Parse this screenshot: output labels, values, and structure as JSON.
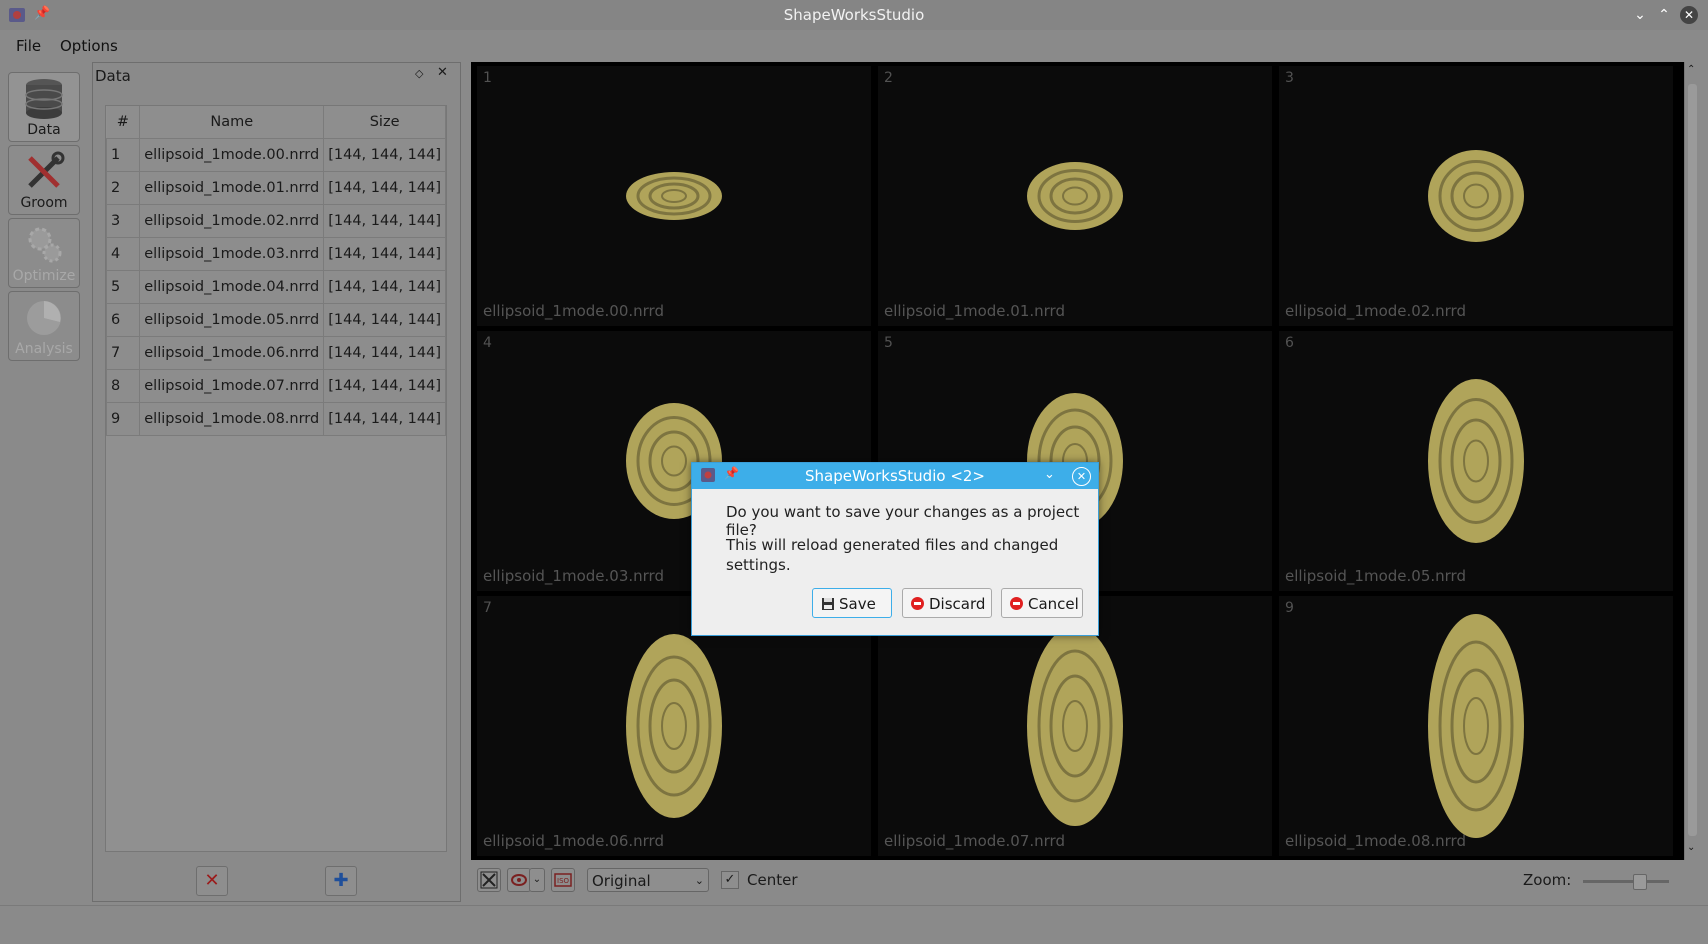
{
  "window": {
    "title": "ShapeWorksStudio"
  },
  "menubar": {
    "file": "File",
    "options": "Options"
  },
  "toolbar": {
    "data": "Data",
    "groom": "Groom",
    "optimize": "Optimize",
    "analysis": "Analysis"
  },
  "dock": {
    "title": "Data",
    "columns": {
      "num": "#",
      "name": "Name",
      "size": "Size"
    },
    "rows": [
      {
        "num": "1",
        "name": "ellipsoid_1mode.00.nrrd",
        "size": "[144, 144, 144]"
      },
      {
        "num": "2",
        "name": "ellipsoid_1mode.01.nrrd",
        "size": "[144, 144, 144]"
      },
      {
        "num": "3",
        "name": "ellipsoid_1mode.02.nrrd",
        "size": "[144, 144, 144]"
      },
      {
        "num": "4",
        "name": "ellipsoid_1mode.03.nrrd",
        "size": "[144, 144, 144]"
      },
      {
        "num": "5",
        "name": "ellipsoid_1mode.04.nrrd",
        "size": "[144, 144, 144]"
      },
      {
        "num": "6",
        "name": "ellipsoid_1mode.05.nrrd",
        "size": "[144, 144, 144]"
      },
      {
        "num": "7",
        "name": "ellipsoid_1mode.06.nrrd",
        "size": "[144, 144, 144]"
      },
      {
        "num": "8",
        "name": "ellipsoid_1mode.07.nrrd",
        "size": "[144, 144, 144]"
      },
      {
        "num": "9",
        "name": "ellipsoid_1mode.08.nrrd",
        "size": "[144, 144, 144]"
      }
    ]
  },
  "viewer": {
    "cells": [
      {
        "num": "1",
        "name": "ellipsoid_1mode.00.nrrd"
      },
      {
        "num": "2",
        "name": "ellipsoid_1mode.01.nrrd"
      },
      {
        "num": "3",
        "name": "ellipsoid_1mode.02.nrrd"
      },
      {
        "num": "4",
        "name": "ellipsoid_1mode.03.nrrd"
      },
      {
        "num": "5",
        "name": ""
      },
      {
        "num": "6",
        "name": "ellipsoid_1mode.05.nrrd"
      },
      {
        "num": "7",
        "name": "ellipsoid_1mode.06.nrrd"
      },
      {
        "num": "8",
        "name": "ellipsoid_1mode.07.nrrd"
      },
      {
        "num": "9",
        "name": "ellipsoid_1mode.08.nrrd"
      }
    ],
    "shape_color": "#b0a45a"
  },
  "bottombar": {
    "display_mode": "Original",
    "center_checked": true,
    "center_label": "Center",
    "zoom_label": "Zoom:"
  },
  "dialog": {
    "title": "ShapeWorksStudio <2>",
    "message": "Do you want to save your changes as a project file?",
    "detail": "This will reload generated files and changed settings.",
    "buttons": {
      "save": "Save",
      "discard": "Discard",
      "cancel": "Cancel"
    }
  },
  "colors": {
    "accent": "#3daee9",
    "window_dimmed": "#8a8a8a",
    "viewer_bg": "#0b0b0b"
  }
}
